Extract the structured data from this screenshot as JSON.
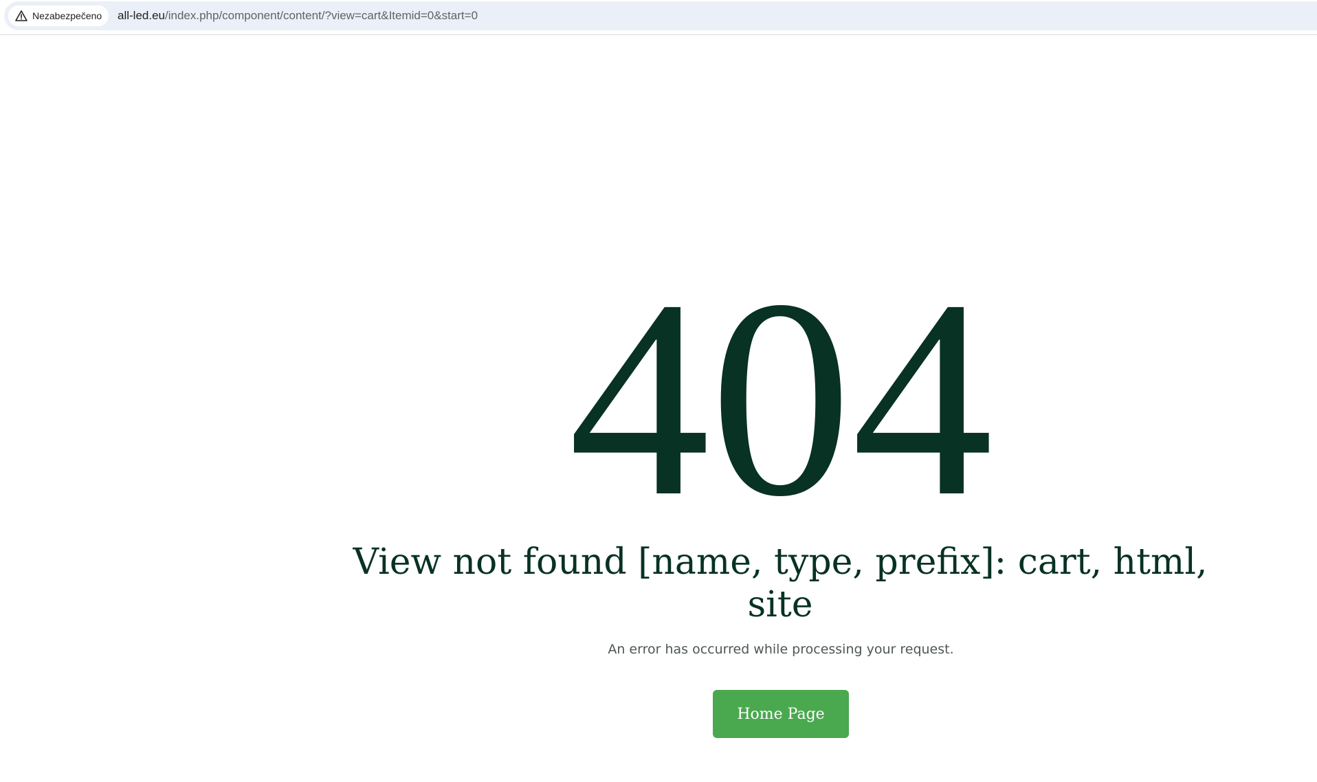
{
  "browser": {
    "security_label": "Nezabezpečeno",
    "security_icon": "warning-triangle-icon",
    "url_domain": "all-led.eu",
    "url_path": "/index.php/component/content/?view=cart&Itemid=0&start=0"
  },
  "error": {
    "code": "404",
    "title": "View not found [name, type, prefix]: cart, html, site",
    "description": "An error has occurred while processing your request.",
    "home_button_label": "Home Page"
  },
  "colors": {
    "heading": "#083223",
    "button": "#4aa84f",
    "omnibox": "#ebeff7"
  }
}
